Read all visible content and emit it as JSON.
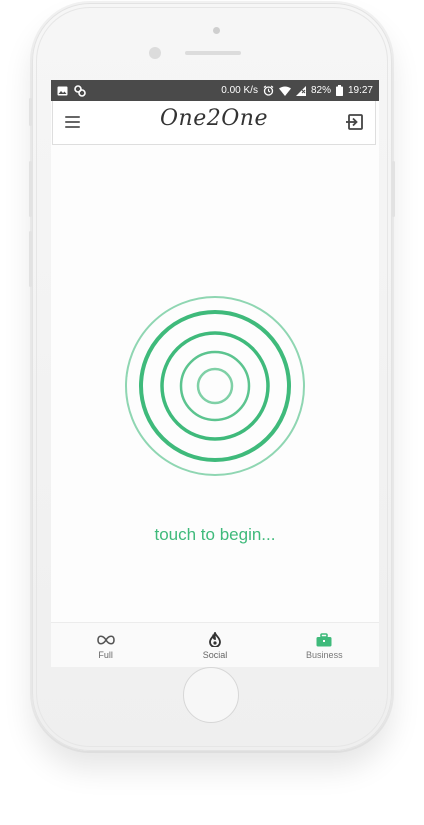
{
  "status_bar": {
    "network_speed": "0.00 K/s",
    "battery": "82%",
    "time": "19:27",
    "icons": [
      "image-icon",
      "link-icon",
      "alarm-icon",
      "wifi-icon",
      "signal-icon",
      "battery-icon"
    ]
  },
  "app_bar": {
    "logo_text": "One2One",
    "menu_icon": "hamburger-menu-icon",
    "exit_icon": "sign-out-icon"
  },
  "main": {
    "prompt_text": "touch to begin...",
    "accent_color": "#3fba7b"
  },
  "bottom_nav": {
    "items": [
      {
        "label": "Full",
        "icon": "infinity-icon"
      },
      {
        "label": "Social",
        "icon": "flame-icon"
      },
      {
        "label": "Business",
        "icon": "briefcase-icon",
        "active": true
      }
    ]
  }
}
